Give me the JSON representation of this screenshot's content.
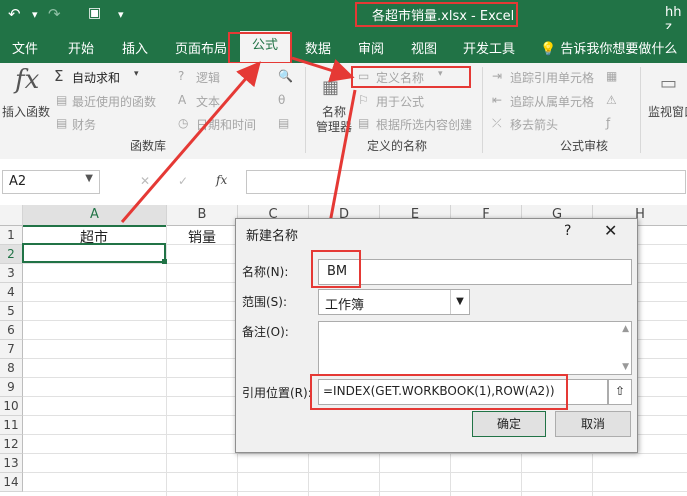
{
  "titlebar": {
    "title": "各超市销量.xlsx  -  Excel",
    "user": "hh z"
  },
  "tabs": [
    "文件",
    "开始",
    "插入",
    "页面布局",
    "公式",
    "数据",
    "审阅",
    "视图",
    "开发工具"
  ],
  "tell_me": "告诉我你想要做什么",
  "ribbon": {
    "insert_function": "插入函数",
    "autosum": "自动求和",
    "recent": "最近使用的函数",
    "financial": "财务",
    "logical": "逻辑",
    "text": "文本",
    "datetime": "日期和时间",
    "function_library": "函数库",
    "name_manager_1": "名称",
    "name_manager_2": "管理器",
    "define_name": "定义名称",
    "use_in_formula": "用于公式",
    "create_from_selection": "根据所选内容创建",
    "defined_names": "定义的名称",
    "trace_precedents": "追踪引用单元格",
    "trace_dependents": "追踪从属单元格",
    "remove_arrows": "移去箭头",
    "formula_auditing": "公式审核",
    "watch_window": "监视窗口"
  },
  "formula_bar": {
    "name_box": "A2",
    "fx": "fx"
  },
  "grid": {
    "columns": [
      "A",
      "B",
      "C",
      "D",
      "E",
      "F",
      "G",
      "H"
    ],
    "rows": [
      "1",
      "2",
      "3",
      "4",
      "5",
      "6",
      "7",
      "8",
      "9",
      "10",
      "11",
      "12",
      "13",
      "14"
    ],
    "a1": "超市",
    "b1": "销量"
  },
  "dialog": {
    "title": "新建名称",
    "help": "?",
    "close": "✕",
    "name_label": "名称(N):",
    "name_value": "BM",
    "scope_label": "范围(S):",
    "scope_value": "工作簿",
    "comment_label": "备注(O):",
    "refers_label": "引用位置(R):",
    "refers_value": "=INDEX(GET.WORKBOOK(1),ROW(A2))",
    "ok": "确定",
    "cancel": "取消"
  },
  "colors": {
    "excel_green": "#217346",
    "highlight_red": "#e53935"
  }
}
